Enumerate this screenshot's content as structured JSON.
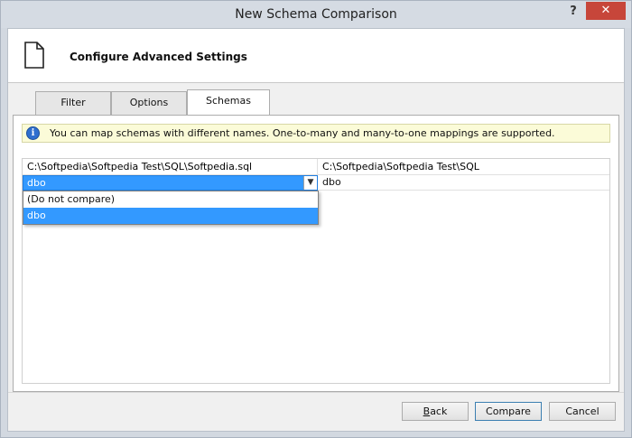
{
  "window": {
    "title": "New Schema Comparison",
    "help_label": "?",
    "close_label": "✕"
  },
  "header": {
    "title": "Configure Advanced Settings",
    "icon": "document-icon"
  },
  "tabs": [
    {
      "label": "Filter",
      "active": false
    },
    {
      "label": "Options",
      "active": false
    },
    {
      "label": "Schemas",
      "active": true
    }
  ],
  "info": {
    "icon": "info-icon",
    "icon_glyph": "i",
    "text": "You can map schemas with different names. One-to-many and many-to-one mappings are supported."
  },
  "grid": {
    "columns": [
      "C:\\Softpedia\\Softpedia Test\\SQL\\Softpedia.sql",
      "C:\\Softpedia\\Softpedia Test\\SQL"
    ],
    "rows": [
      {
        "source": "dbo",
        "target": "dbo"
      }
    ],
    "dropdown": {
      "options": [
        "(Do not compare)",
        "dbo"
      ],
      "selected": "dbo"
    }
  },
  "buttons": {
    "back": {
      "mnemonic": "B",
      "rest": "ack"
    },
    "compare": "Compare",
    "cancel": "Cancel"
  },
  "colors": {
    "selection": "#3399ff",
    "info_background": "#fbfbd8",
    "close_button": "#c7463a"
  }
}
